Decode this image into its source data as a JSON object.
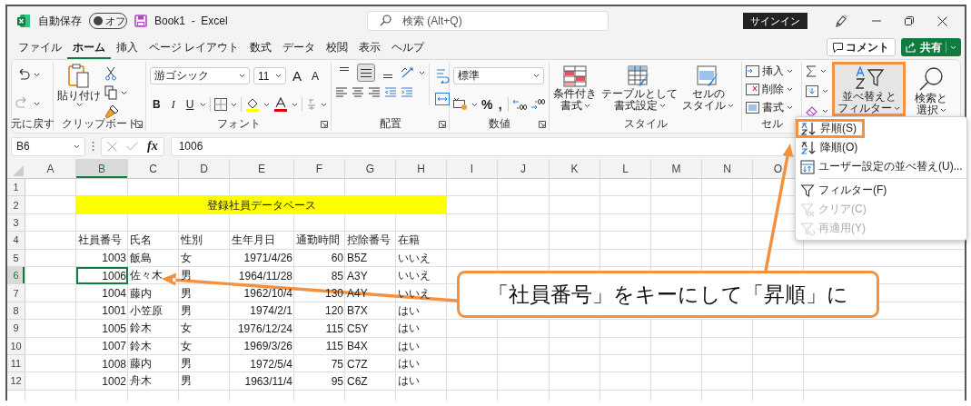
{
  "title_bar": {
    "autosave_label": "自動保存",
    "autosave": {
      "label": "オフ",
      "on": false
    },
    "workbook_title": "Book1  -  Excel",
    "search": {
      "placeholder": "検索 (Alt+Q)"
    },
    "sign_in": "サインイン"
  },
  "menu_tabs": [
    {
      "label": "ファイル",
      "selected": false
    },
    {
      "label": "ホーム",
      "selected": true
    },
    {
      "label": "挿入",
      "selected": false
    },
    {
      "label": "ページ レイアウト",
      "selected": false
    },
    {
      "label": "数式",
      "selected": false
    },
    {
      "label": "データ",
      "selected": false
    },
    {
      "label": "校閲",
      "selected": false
    },
    {
      "label": "表示",
      "selected": false
    },
    {
      "label": "ヘルプ",
      "selected": false
    }
  ],
  "comment_button": "コメント",
  "share_button": "共有",
  "ribbon": {
    "undo": {
      "label": "元に戻す",
      "redo_disabled": true
    },
    "clipboard": {
      "label": "クリップボード",
      "paste": "貼り付け"
    },
    "font": {
      "label": "フォント",
      "font_name": "游ゴシック",
      "font_size": "11",
      "size_buttons": [
        "A",
        "A"
      ],
      "style_buttons": [
        "B",
        "I",
        "U"
      ]
    },
    "alignment": {
      "label": "配置",
      "vertical": [
        {
          "kind": "top",
          "selected": false
        },
        {
          "kind": "middle",
          "selected": true
        },
        {
          "kind": "bottom",
          "selected": false
        }
      ]
    },
    "number": {
      "label": "数値",
      "format": "標準",
      "symbols": [
        "%",
        ","
      ]
    },
    "styles": {
      "label": "スタイル",
      "buttons": [
        {
          "kind": "conditional",
          "lines": [
            "条件付き",
            "書式"
          ]
        },
        {
          "kind": "table",
          "lines": [
            "テーブルとして",
            "書式設定"
          ]
        },
        {
          "kind": "cell-style",
          "lines": [
            "セルの",
            "スタイル"
          ]
        }
      ]
    },
    "cells": {
      "label": "セル",
      "buttons": [
        {
          "kind": "insert",
          "label": "挿入"
        },
        {
          "kind": "delete",
          "label": "削除"
        },
        {
          "kind": "format",
          "label": "書式"
        }
      ]
    },
    "editing": {
      "buttons": [
        {
          "kind": "sort",
          "lines": [
            "並べ替えと",
            "フィルター"
          ],
          "highlighted": true
        },
        {
          "kind": "find",
          "lines": [
            "検索と",
            "選択"
          ],
          "highlighted": false
        }
      ]
    }
  },
  "formula_bar": {
    "name_box": "B6",
    "function_label": "fx",
    "value": "1006"
  },
  "sheet": {
    "columns": [
      {
        "label": "A",
        "selected": false
      },
      {
        "label": "B",
        "selected": true
      },
      {
        "label": "C",
        "selected": false
      },
      {
        "label": "D",
        "selected": false
      },
      {
        "label": "E",
        "selected": false
      },
      {
        "label": "F",
        "selected": false
      },
      {
        "label": "G",
        "selected": false
      },
      {
        "label": "H",
        "selected": false
      },
      {
        "label": "I",
        "selected": false
      },
      {
        "label": "J",
        "selected": false
      },
      {
        "label": "K",
        "selected": false
      },
      {
        "label": "L",
        "selected": false
      },
      {
        "label": "M",
        "selected": false
      },
      {
        "label": "N",
        "selected": false
      },
      {
        "label": "O",
        "selected": false
      }
    ],
    "rows": [
      {
        "number": "1",
        "selected": false
      },
      {
        "number": "2",
        "selected": false,
        "banner": "登録社員データベース"
      },
      {
        "number": "3",
        "selected": false
      },
      {
        "number": "4",
        "selected": false,
        "cells": [
          {
            "text": "社員番号",
            "kind": "text",
            "selected": false
          },
          {
            "text": "氏名",
            "kind": "text",
            "selected": false
          },
          {
            "text": "性別",
            "kind": "text",
            "selected": false
          },
          {
            "text": "生年月日",
            "kind": "text",
            "selected": false
          },
          {
            "text": "通勤時間",
            "kind": "text",
            "selected": false
          },
          {
            "text": "控除番号",
            "kind": "text",
            "selected": false
          },
          {
            "text": "在籍",
            "kind": "text",
            "selected": false
          }
        ]
      },
      {
        "number": "5",
        "selected": false,
        "cells": [
          {
            "text": "1003",
            "kind": "number",
            "selected": false
          },
          {
            "text": "飯島",
            "kind": "text",
            "selected": false
          },
          {
            "text": "女",
            "kind": "text",
            "selected": false
          },
          {
            "text": "1971/4/26",
            "kind": "number",
            "selected": false
          },
          {
            "text": "60",
            "kind": "number",
            "selected": false
          },
          {
            "text": "B5Z",
            "kind": "text",
            "selected": false
          },
          {
            "text": "いいえ",
            "kind": "text",
            "selected": false
          }
        ]
      },
      {
        "number": "6",
        "selected": true,
        "cells": [
          {
            "text": "1006",
            "kind": "number",
            "selected": true
          },
          {
            "text": "佐々木",
            "kind": "text",
            "selected": false
          },
          {
            "text": "男",
            "kind": "text",
            "selected": false
          },
          {
            "text": "1964/11/28",
            "kind": "number",
            "selected": false
          },
          {
            "text": "85",
            "kind": "number",
            "selected": false
          },
          {
            "text": "A3Y",
            "kind": "text",
            "selected": false
          },
          {
            "text": "いいえ",
            "kind": "text",
            "selected": false
          }
        ]
      },
      {
        "number": "7",
        "selected": false,
        "cells": [
          {
            "text": "1004",
            "kind": "number",
            "selected": false
          },
          {
            "text": "藤内",
            "kind": "text",
            "selected": false
          },
          {
            "text": "男",
            "kind": "text",
            "selected": false
          },
          {
            "text": "1962/10/4",
            "kind": "number",
            "selected": false
          },
          {
            "text": "130",
            "kind": "number",
            "selected": false
          },
          {
            "text": "A4Y",
            "kind": "text",
            "selected": false
          },
          {
            "text": "いいえ",
            "kind": "text",
            "selected": false
          }
        ]
      },
      {
        "number": "8",
        "selected": false,
        "cells": [
          {
            "text": "1001",
            "kind": "number",
            "selected": false
          },
          {
            "text": "小笠原",
            "kind": "text",
            "selected": false
          },
          {
            "text": "男",
            "kind": "text",
            "selected": false
          },
          {
            "text": "1974/2/1",
            "kind": "number",
            "selected": false
          },
          {
            "text": "120",
            "kind": "number",
            "selected": false
          },
          {
            "text": "B7X",
            "kind": "text",
            "selected": false
          },
          {
            "text": "はい",
            "kind": "text",
            "selected": false
          }
        ]
      },
      {
        "number": "9",
        "selected": false,
        "cells": [
          {
            "text": "1005",
            "kind": "number",
            "selected": false
          },
          {
            "text": "鈴木",
            "kind": "text",
            "selected": false
          },
          {
            "text": "女",
            "kind": "text",
            "selected": false
          },
          {
            "text": "1976/12/24",
            "kind": "number",
            "selected": false
          },
          {
            "text": "115",
            "kind": "number",
            "selected": false
          },
          {
            "text": "C5Y",
            "kind": "text",
            "selected": false
          },
          {
            "text": "はい",
            "kind": "text",
            "selected": false
          }
        ]
      },
      {
        "number": "10",
        "selected": false,
        "cells": [
          {
            "text": "1007",
            "kind": "number",
            "selected": false
          },
          {
            "text": "鈴木",
            "kind": "text",
            "selected": false
          },
          {
            "text": "女",
            "kind": "text",
            "selected": false
          },
          {
            "text": "1969/3/26",
            "kind": "number",
            "selected": false
          },
          {
            "text": "115",
            "kind": "number",
            "selected": false
          },
          {
            "text": "B4X",
            "kind": "text",
            "selected": false
          },
          {
            "text": "はい",
            "kind": "text",
            "selected": false
          }
        ]
      },
      {
        "number": "11",
        "selected": false,
        "cells": [
          {
            "text": "1008",
            "kind": "number",
            "selected": false
          },
          {
            "text": "藤内",
            "kind": "text",
            "selected": false
          },
          {
            "text": "男",
            "kind": "text",
            "selected": false
          },
          {
            "text": "1972/5/4",
            "kind": "number",
            "selected": false
          },
          {
            "text": "75",
            "kind": "number",
            "selected": false
          },
          {
            "text": "C7Z",
            "kind": "text",
            "selected": false
          },
          {
            "text": "はい",
            "kind": "text",
            "selected": false
          }
        ]
      },
      {
        "number": "12",
        "selected": false,
        "cells": [
          {
            "text": "1002",
            "kind": "number",
            "selected": false
          },
          {
            "text": "舟木",
            "kind": "text",
            "selected": false
          },
          {
            "text": "男",
            "kind": "text",
            "selected": false
          },
          {
            "text": "1963/11/4",
            "kind": "number",
            "selected": false
          },
          {
            "text": "95",
            "kind": "number",
            "selected": false
          },
          {
            "text": "C6Z",
            "kind": "text",
            "selected": false
          },
          {
            "text": "はい",
            "kind": "text",
            "selected": false
          }
        ]
      }
    ]
  },
  "sort_menu": {
    "sort_items": [
      {
        "kind": "ascending",
        "label": "昇順(S)",
        "disabled": false,
        "highlighted": true
      },
      {
        "kind": "descending",
        "label": "降順(O)",
        "disabled": false,
        "highlighted": false
      },
      {
        "kind": "custom",
        "label": "ユーザー設定の並べ替え(U)...",
        "disabled": false,
        "highlighted": false
      }
    ],
    "filter_items": [
      {
        "kind": "filter",
        "label": "フィルター(F)",
        "disabled": false,
        "highlighted": false
      },
      {
        "kind": "clear",
        "label": "クリア(C)",
        "disabled": true,
        "highlighted": false
      },
      {
        "kind": "reapply",
        "label": "再適用(Y)",
        "disabled": true,
        "highlighted": false
      }
    ]
  },
  "callout": {
    "text": "「社員番号」をキーにして「昇順」に"
  }
}
